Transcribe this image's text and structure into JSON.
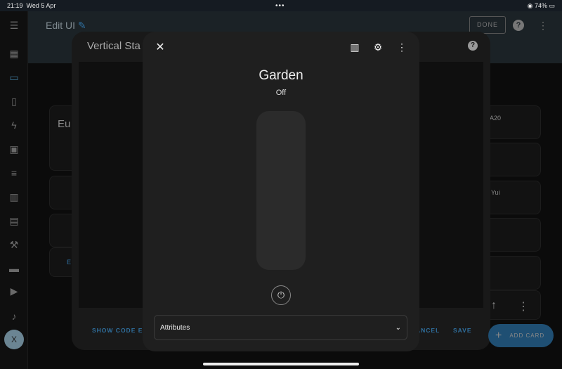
{
  "status": {
    "time": "21:19",
    "date": "Wed 5 Apr",
    "dots": "•••",
    "battery": "74%"
  },
  "header": {
    "title": "Edit UI",
    "done": "DONE"
  },
  "sidebar": {
    "avatar": "X"
  },
  "background": {
    "card1": "Eu",
    "edit": "E",
    "right1": "A20",
    "right2": "Yui"
  },
  "editor": {
    "title": "Vertical Sta",
    "show_code": "SHOW CODE EDI",
    "cancel": "ANCEL",
    "save": "SAVE"
  },
  "dialog": {
    "name": "Garden",
    "state": "Off",
    "attributes": "Attributes"
  },
  "fab": {
    "label": "ADD CARD"
  },
  "colors": {
    "accent": "#2f6f9e"
  }
}
